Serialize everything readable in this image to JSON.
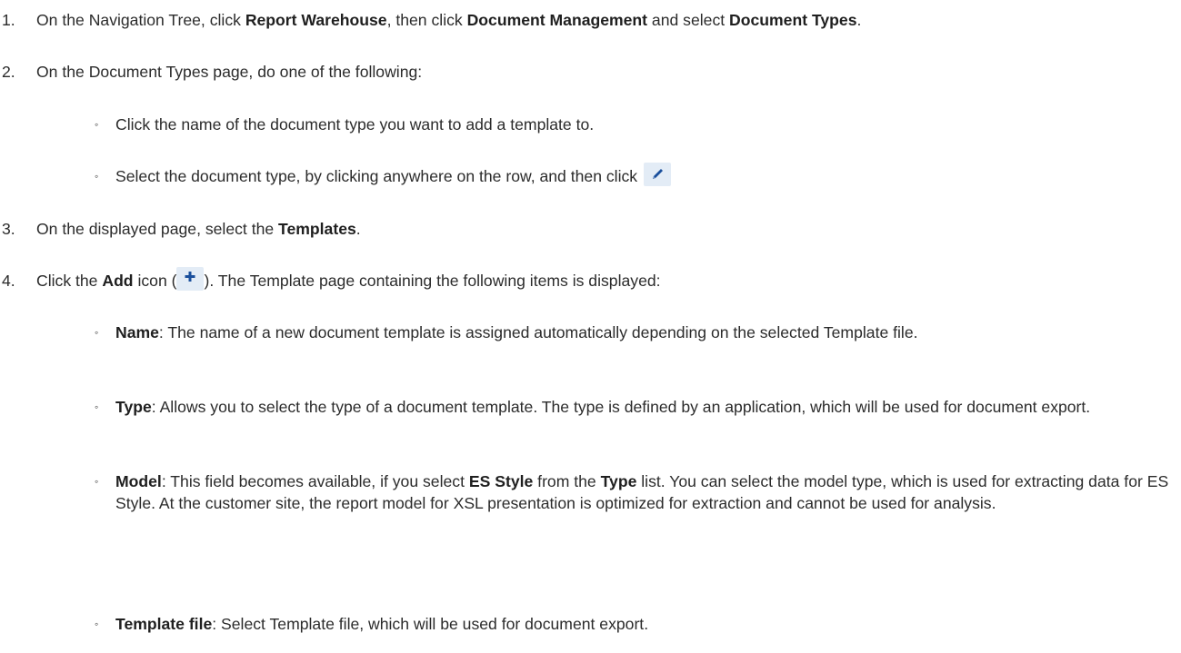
{
  "steps": [
    {
      "number": "1.",
      "parts": {
        "t1": "On the Navigation Tree, click ",
        "b1": "Report Warehouse",
        "t2": ", then click ",
        "b2": "Document Management",
        "t3": " and select ",
        "b3": "Document Types",
        "t4": "."
      }
    },
    {
      "number": "2.",
      "text": "On the Document Types page, do one of the following:",
      "bullets": [
        {
          "text": "Click the name of the document type you want to add a template to."
        },
        {
          "text": "Select the document type, by clicking anywhere on the row, and then click ",
          "icon": "edit-pencil-icon"
        }
      ]
    },
    {
      "number": "3.",
      "parts": {
        "t1": "On the displayed page, select the ",
        "b1": "Templates",
        "t2": "."
      }
    },
    {
      "number": "4.",
      "parts": {
        "t1": "Click the ",
        "b1": "Add",
        "t2": " icon (",
        "icon": "add-plus-icon",
        "t3": "). The Template page containing the following items is displayed:"
      },
      "bullets": [
        {
          "label": "Name",
          "text": ": The name of a new document template is assigned automatically depending on the selected Template file."
        },
        {
          "label": "Type",
          "text": ": Allows you to select the type of a document template. The type is defined by an application, which will be used for document export."
        },
        {
          "label": "Model",
          "t1": ": This field becomes available, if you select ",
          "b1": "ES Style",
          "t2": " from the ",
          "b2": "Type",
          "t3": " list. You can select the model type, which is used for extracting data for ES Style. At the customer site, the report model for XSL presentation is optimized for extraction and cannot be used for analysis."
        },
        {
          "label": "Template file",
          "text": ": Select Template file, which will be used for document export."
        }
      ]
    }
  ],
  "colors": {
    "text": "#2b2b2b",
    "icon_bg": "#e3ecf6",
    "icon_fg": "#1a4f9c"
  }
}
